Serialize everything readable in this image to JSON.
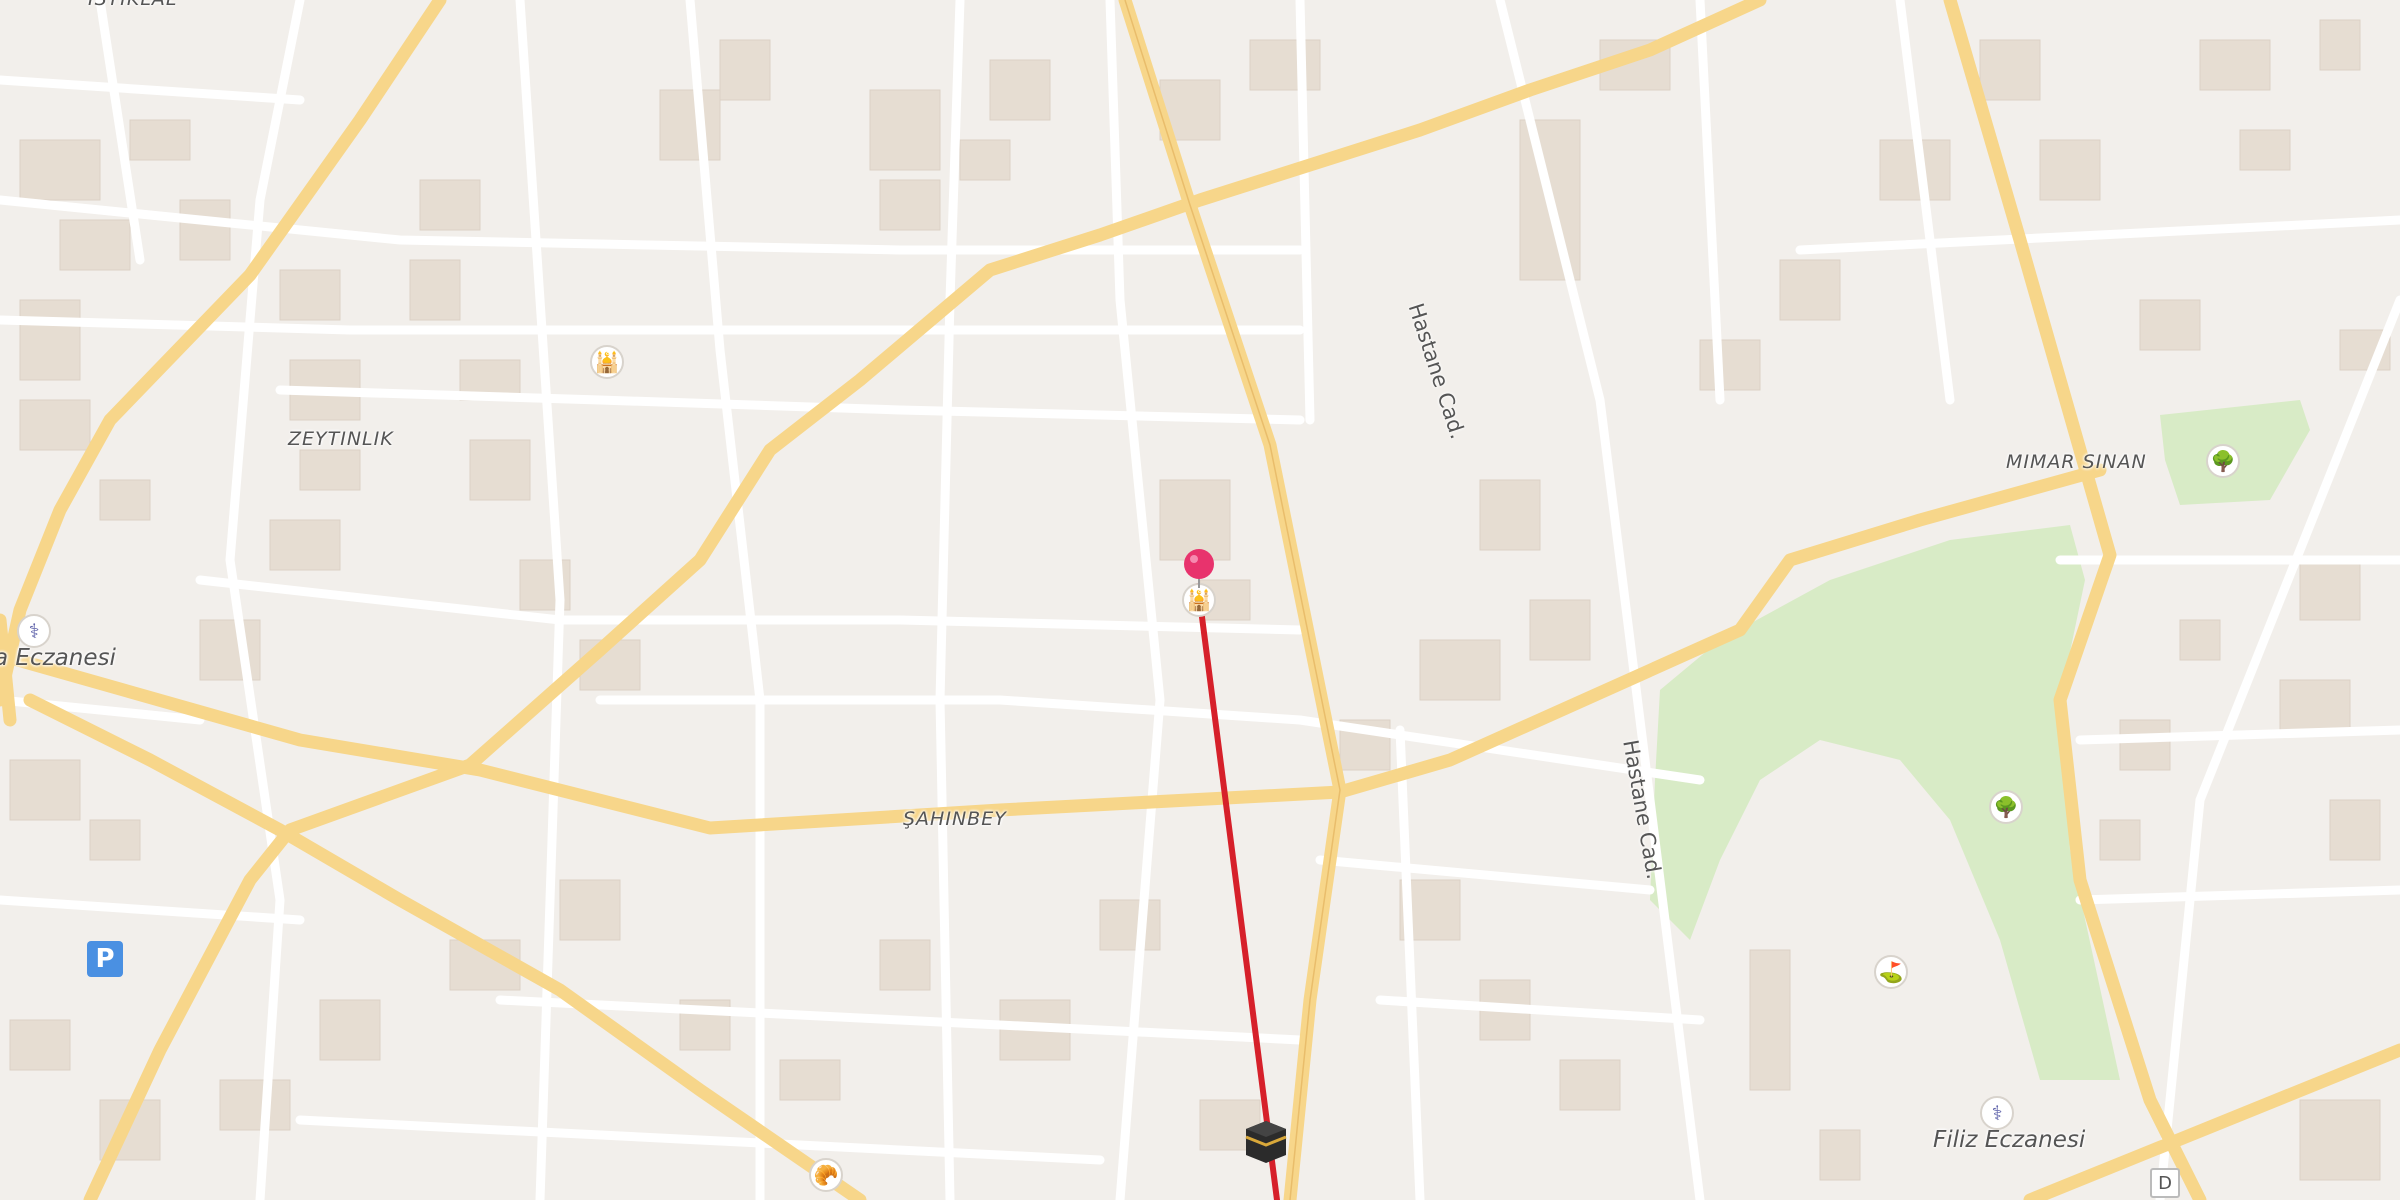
{
  "map": {
    "areas": {
      "zeytinlik": "ZEYTINLIK",
      "istiklal": "ISTIKLAL",
      "mimar_sinan": "MIMAR SINAN",
      "sahinbey": "ŞAHINBEY"
    },
    "streets": {
      "hastane_1": "Hastane Cad.",
      "hastane_2": "Hastane Cad."
    },
    "pois": {
      "pharmacy_left": "a Eczanesi",
      "pharmacy_right": "Filiz Eczanesi",
      "route_shield": "D"
    },
    "icons": [
      "mosque-icon",
      "pharmacy-icon",
      "tree-icon",
      "parking-icon",
      "bakery-icon",
      "kaaba-icon",
      "location-pin-icon",
      "stadium-icon"
    ],
    "colors": {
      "land": "#f2efeb",
      "road_major": "#f7d68a",
      "road_minor": "#ffffff",
      "building": "#e6ddd2",
      "park": "#d8ebc6",
      "route": "#d6202a",
      "pin": "#e8336d",
      "pharmacy_icon": "#5b5fa8",
      "parking": "#4a90e2"
    }
  }
}
